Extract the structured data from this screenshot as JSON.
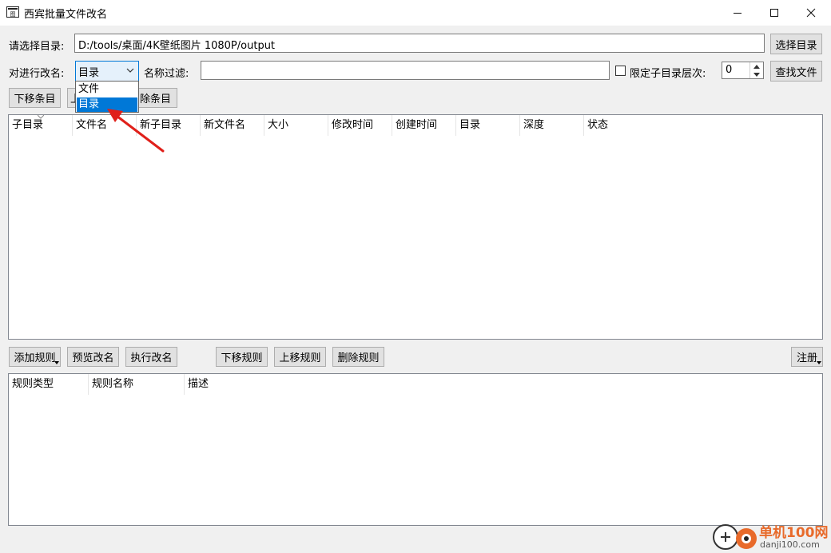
{
  "window": {
    "title": "西宾批量文件改名",
    "minimize_icon": "minimize-icon",
    "maximize_icon": "maximize-icon",
    "close_icon": "close-icon"
  },
  "directory": {
    "label": "请选择目录:",
    "value": "D:/tools/桌面/4K壁纸图片 1080P/output",
    "button": "选择目录"
  },
  "rename_target": {
    "label": "对进行改名:",
    "selected": "目录",
    "options": [
      "文件",
      "目录"
    ],
    "highlighted": "目录"
  },
  "name_filter": {
    "label": "名称过滤:",
    "value": ""
  },
  "depth_limit": {
    "label": "限定子目录层次:",
    "checked": false,
    "value": "0"
  },
  "find_files_button": "查找文件",
  "entry_toolbar": {
    "move_down": "下移条目",
    "move_up_partial": "上",
    "delete_partial": "除条目"
  },
  "file_table": {
    "columns": [
      "子目录",
      "文件名",
      "新子目录",
      "新文件名",
      "大小",
      "修改时间",
      "创建时间",
      "目录",
      "深度",
      "状态"
    ],
    "rows": []
  },
  "rule_toolbar": {
    "add_rule": "添加规则",
    "preview": "预览改名",
    "execute": "执行改名",
    "move_down_rule": "下移规则",
    "move_up_rule": "上移规则",
    "delete_rule": "删除规则",
    "register": "注册"
  },
  "rule_table": {
    "columns": [
      "规则类型",
      "规则名称",
      "描述"
    ],
    "rows": []
  },
  "watermark": {
    "line1": "单机100网",
    "line2": "danji100.com"
  },
  "colors": {
    "accent": "#0078d7",
    "arrow": "#e0201a",
    "watermark_orange": "#e86a2a"
  }
}
